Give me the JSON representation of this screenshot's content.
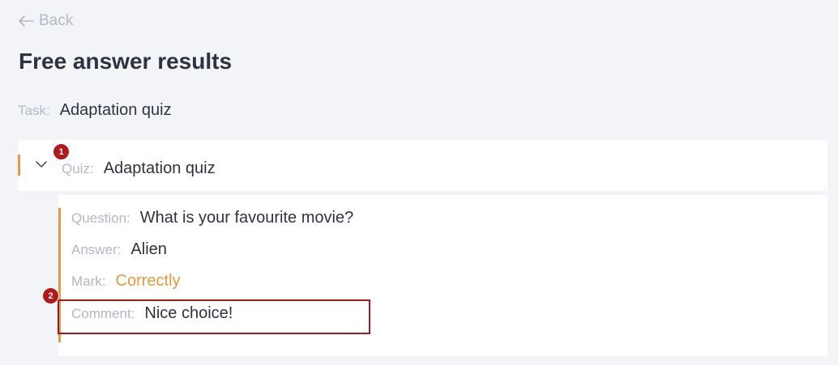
{
  "nav": {
    "back_label": "Back"
  },
  "page": {
    "title": "Free answer results"
  },
  "task": {
    "label": "Task:",
    "value": "Adaptation quiz"
  },
  "quiz": {
    "label": "Quiz:",
    "value": "Adaptation quiz",
    "expanded": true
  },
  "details": {
    "question_label": "Question:",
    "question_value": "What is your favourite movie?",
    "answer_label": "Answer:",
    "answer_value": "Alien",
    "mark_label": "Mark:",
    "mark_value": "Correctly",
    "comment_label": "Comment:",
    "comment_value": "Nice choice!"
  },
  "annotations": {
    "badge_1": "1",
    "badge_2": "2"
  },
  "colors": {
    "accent": "#e09a3f",
    "badge": "#b11a1a",
    "highlight": "#a8191b",
    "muted_text": "#b3b7c6",
    "body_text": "#2f3240",
    "page_bg": "#f3f4f8"
  },
  "icons": {
    "back": "arrow-left-icon",
    "expand": "chevron-down-icon"
  }
}
